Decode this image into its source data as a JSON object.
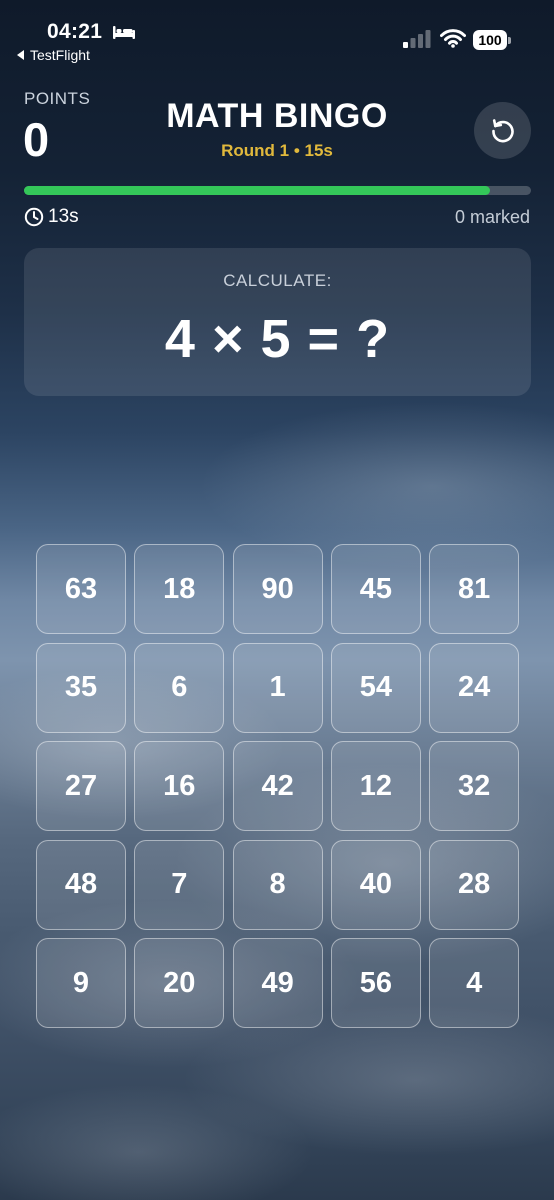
{
  "status_bar": {
    "time": "04:21",
    "back_label": "TestFlight",
    "battery": "100"
  },
  "header": {
    "points_label": "POINTS",
    "points_value": "0",
    "title": "MATH BINGO",
    "round_info": "Round 1 • 15s"
  },
  "progress": {
    "fraction": 0.92,
    "color": "#34c759"
  },
  "timer_text": "13s",
  "marked_text": "0 marked",
  "question": {
    "label": "CALCULATE:",
    "text": "4 × 5 = ?"
  },
  "grid": [
    [
      "63",
      "18",
      "90",
      "45",
      "81"
    ],
    [
      "35",
      "6",
      "1",
      "54",
      "24"
    ],
    [
      "27",
      "16",
      "42",
      "12",
      "32"
    ],
    [
      "48",
      "7",
      "8",
      "40",
      "28"
    ],
    [
      "9",
      "20",
      "49",
      "56",
      "4"
    ]
  ],
  "colors": {
    "accent_gold": "#e1b93c",
    "progress_green": "#34c759"
  },
  "icons": [
    "bed-icon",
    "back-arrow-icon",
    "signal-icon",
    "wifi-icon",
    "battery-icon",
    "reset-icon",
    "clock-icon"
  ]
}
